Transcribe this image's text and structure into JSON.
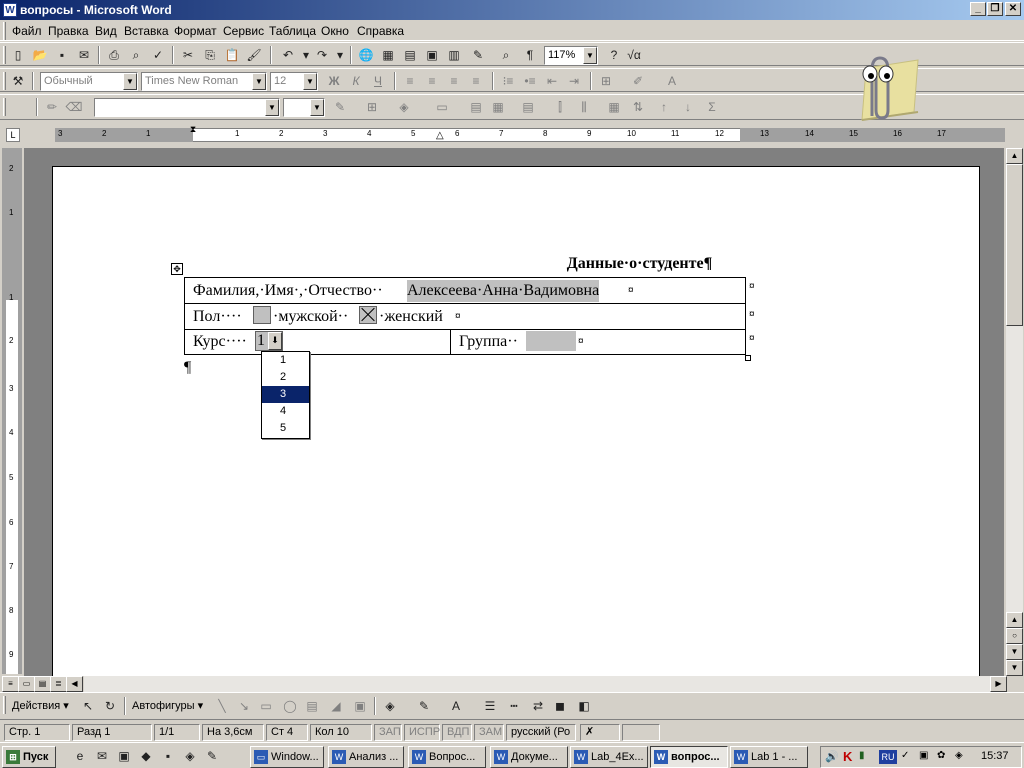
{
  "window": {
    "title": "вопросы - Microsoft Word",
    "app_icon": "W"
  },
  "menu": [
    "Файл",
    "Правка",
    "Вид",
    "Вставка",
    "Формат",
    "Сервис",
    "Таблица",
    "Окно",
    "Справка"
  ],
  "toolbar": {
    "zoom": "117%",
    "style": "Обычный",
    "font": "Times New Roman",
    "size": "12",
    "bold": "Ж",
    "italic": "К",
    "underline": "Ч",
    "pilcrow": "¶"
  },
  "ruler": {
    "labels": [
      "3",
      "2",
      "1",
      "1",
      "2",
      "3",
      "4",
      "5",
      "6",
      "7",
      "8",
      "9",
      "10",
      "11",
      "12",
      "13",
      "14",
      "15",
      "16",
      "17"
    ]
  },
  "vruler": {
    "labels": [
      "2",
      "1",
      "1",
      "2",
      "3",
      "4",
      "5",
      "6",
      "7",
      "8",
      "9"
    ]
  },
  "document": {
    "title": "Данные·о·студенте¶",
    "row1": {
      "label": "Фамилия,·Имя·,·Отчество··",
      "value": "Алексеева·Анна·Вадимовна",
      "end": "¤"
    },
    "row2": {
      "label": "Пол····",
      "male": "·мужской··",
      "female": "·женский",
      "end": "¤"
    },
    "row3": {
      "label": "Курс····",
      "value": "1",
      "group_label": "Группа··",
      "end": "¤"
    },
    "paragraph_mark": "¶",
    "dropdown": {
      "options": [
        "1",
        "2",
        "3",
        "4",
        "5"
      ],
      "selected": "3"
    }
  },
  "drawbar": {
    "actions": "Действия ▾",
    "autoshapes": "Автофигуры ▾"
  },
  "status": {
    "page": "Стр. 1",
    "section": "Разд 1",
    "pages": "1/1",
    "at": "На 3,6см",
    "line": "Ст 4",
    "col": "Кол 10",
    "rec": "ЗАП",
    "trk": "ИСПР",
    "ext": "ВДП",
    "ovr": "ЗАМ",
    "lang": "русский (Ро"
  },
  "taskbar": {
    "start": "Пуск",
    "items": [
      "Window...",
      "Анализ ...",
      "Вопрос...",
      "Докуме...",
      "Lab_4Ex...",
      "вопрос...",
      "Lab 1 - ..."
    ],
    "active_index": 5,
    "lang": "RU",
    "time": "15:37"
  },
  "colors": {
    "titlebar": "#0a246a",
    "field": "#c0c0c0",
    "selection": "#0a246a"
  }
}
